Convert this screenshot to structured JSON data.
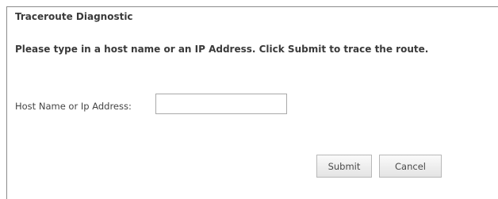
{
  "form": {
    "title": "Traceroute Diagnostic",
    "instructions": "Please type in a host name or an IP Address. Click Submit to trace the route.",
    "host_label": "Host Name or Ip Address:",
    "host_value": "",
    "submit_label": "Submit",
    "cancel_label": "Cancel"
  }
}
